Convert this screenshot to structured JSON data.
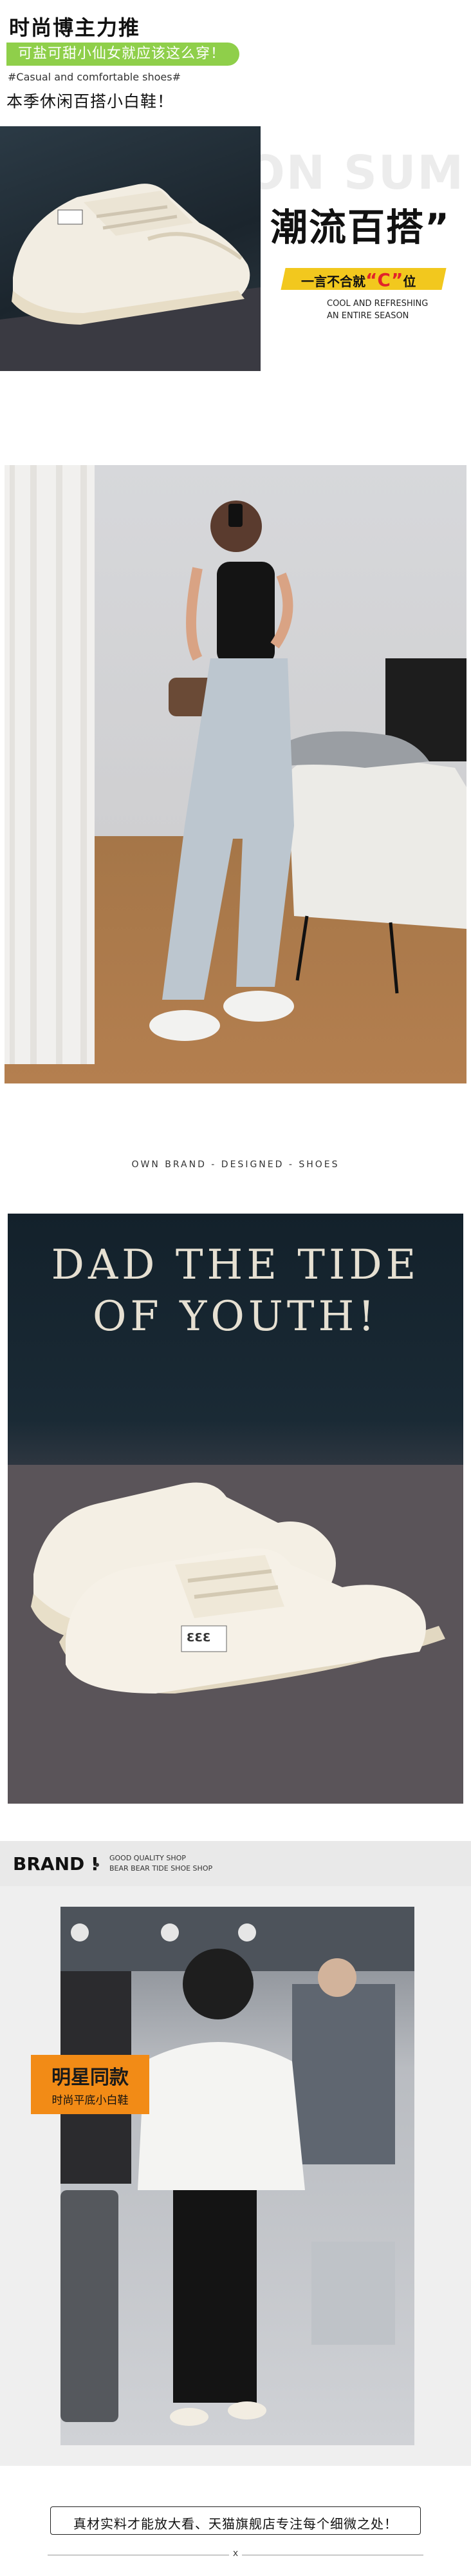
{
  "header": {
    "title": "时尚博主力推",
    "pill": "可盐可甜小仙女就应该这么穿！",
    "tag": "#Casual and comfortable shoes#",
    "subtitle": "本季休闲百搭小白鞋！"
  },
  "hero": {
    "bg_text": "ON SUM",
    "title": "潮流百搭”",
    "badge_prefix": "一言不合就",
    "badge_c": "“C”",
    "badge_suffix": "位",
    "en_line1": "COOL AND REFRESHING",
    "en_line2": "AN ENTIRE SEASON"
  },
  "own_brand": "OWN BRAND  -  DESIGNED  -  SHOES",
  "dad_section": {
    "title_line1": "DAD THE TIDE",
    "title_line2": "OF YOUTH!",
    "shoe_label": "ƐƐƐ"
  },
  "brand": {
    "name": "BRAND !",
    "line1": "GOOD QUALITY SHOP",
    "line2": "BEAR BEAR TIDE SHOE SHOP"
  },
  "star": {
    "title": "明星同款",
    "subtitle": "时尚平底小白鞋"
  },
  "footer": {
    "text": "真材实料才能放大看、天猫旗舰店专注每个细微之处！",
    "x_mark": "x"
  },
  "colors": {
    "pill_green": "#8fcf4a",
    "badge_yellow": "#f2c81e",
    "badge_c_red": "#e2232a",
    "star_orange": "#f28b16",
    "brand_bar": "#e9e9e9"
  }
}
